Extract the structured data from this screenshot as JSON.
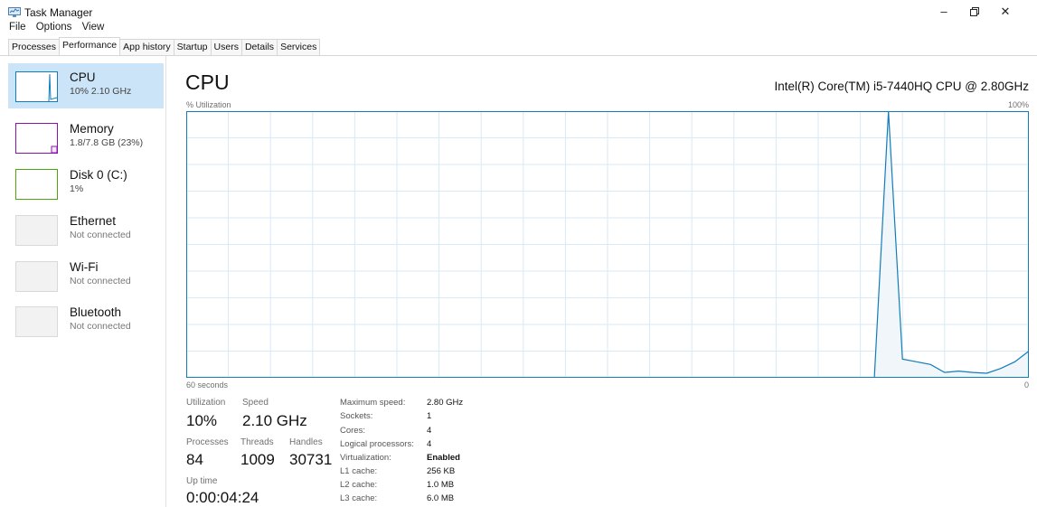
{
  "window": {
    "title": "Task Manager"
  },
  "menu": [
    "File",
    "Options",
    "View"
  ],
  "tabs": [
    "Processes",
    "Performance",
    "App history",
    "Startup",
    "Users",
    "Details",
    "Services"
  ],
  "sidebar": [
    {
      "name": "CPU",
      "sub": "10% 2.10 GHz",
      "color": "#117dbb"
    },
    {
      "name": "Memory",
      "sub": "1.8/7.8 GB (23%)",
      "color": "#8b12ae"
    },
    {
      "name": "Disk 0 (C:)",
      "sub": "1%",
      "color": "#4da60c"
    },
    {
      "name": "Ethernet",
      "sub": "Not connected"
    },
    {
      "name": "Wi-Fi",
      "sub": "Not connected"
    },
    {
      "name": "Bluetooth",
      "sub": "Not connected"
    }
  ],
  "main": {
    "title": "CPU",
    "model": "Intel(R) Core(TM) i5-7440HQ CPU @ 2.80GHz",
    "graph_label": "% Utilization",
    "graph_max": "100%",
    "graph_time": "60 seconds",
    "graph_min": "0"
  },
  "stats": {
    "utilization_label": "Utilization",
    "utilization": "10%",
    "speed_label": "Speed",
    "speed": "2.10 GHz",
    "processes_label": "Processes",
    "processes": "84",
    "threads_label": "Threads",
    "threads": "1009",
    "handles_label": "Handles",
    "handles": "30731",
    "uptime_label": "Up time",
    "uptime": "0:00:04:24"
  },
  "specs": [
    {
      "label": "Maximum speed:",
      "value": "2.80 GHz"
    },
    {
      "label": "Sockets:",
      "value": "1"
    },
    {
      "label": "Cores:",
      "value": "4"
    },
    {
      "label": "Logical processors:",
      "value": "4"
    },
    {
      "label": "Virtualization:",
      "value": "Enabled"
    },
    {
      "label": "L1 cache:",
      "value": "256 KB"
    },
    {
      "label": "L2 cache:",
      "value": "1.0 MB"
    },
    {
      "label": "L3 cache:",
      "value": "6.0 MB"
    }
  ],
  "chart_data": {
    "type": "area",
    "ylim": [
      0,
      100
    ],
    "points": [
      {
        "x": 60,
        "y": 0
      },
      {
        "x": 11,
        "y": 0
      },
      {
        "x": 10,
        "y": 100
      },
      {
        "x": 9,
        "y": 7
      },
      {
        "x": 8,
        "y": 6
      },
      {
        "x": 7,
        "y": 5
      },
      {
        "x": 6,
        "y": 2
      },
      {
        "x": 5,
        "y": 2.5
      },
      {
        "x": 4,
        "y": 2
      },
      {
        "x": 3,
        "y": 1.7
      },
      {
        "x": 2,
        "y": 3.5
      },
      {
        "x": 1,
        "y": 6
      },
      {
        "x": 0,
        "y": 10
      }
    ],
    "colors": {
      "line": "#117dbb",
      "fill": "#f1f6fa",
      "grid": "#d9eaf5"
    }
  }
}
